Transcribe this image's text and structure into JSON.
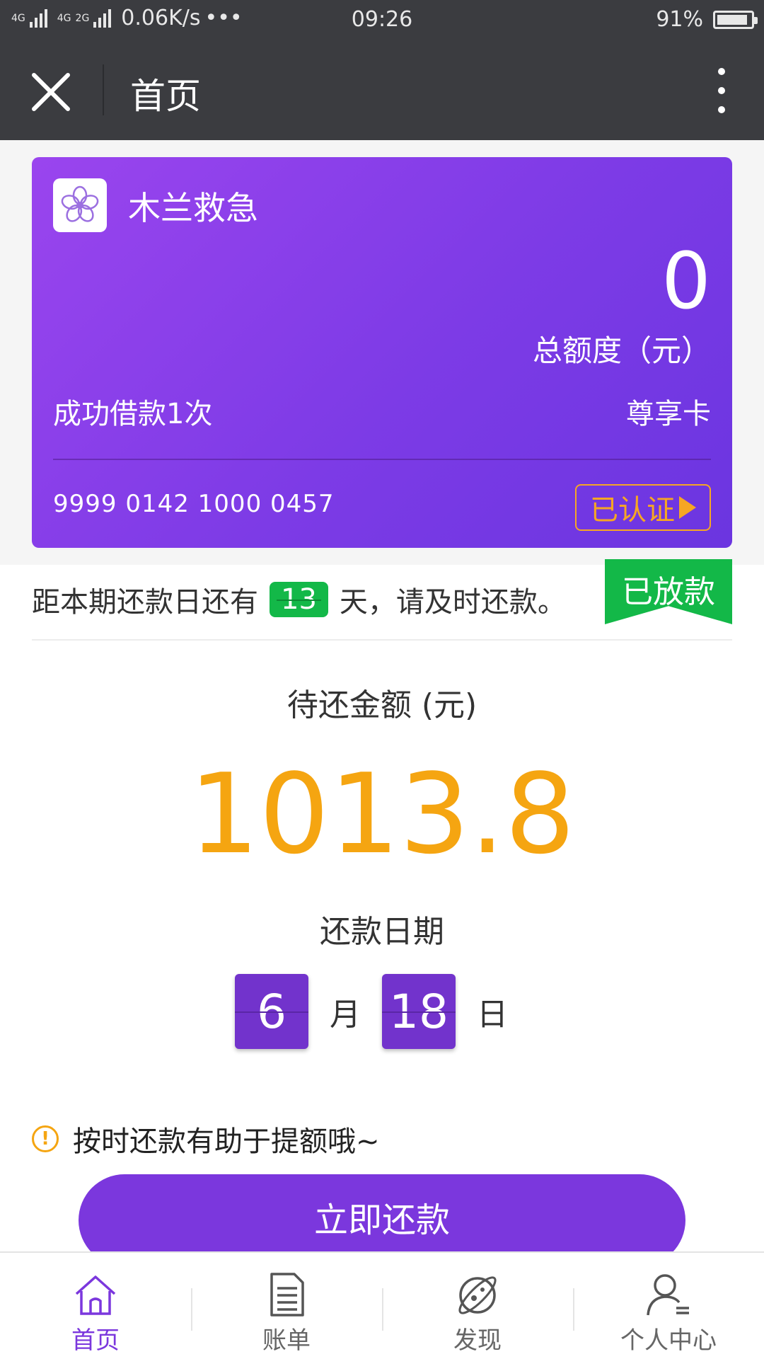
{
  "status_bar": {
    "network_a": "4G",
    "network_b": "4G",
    "network_c": "2G",
    "speed": "0.06K/s",
    "more": "•••",
    "time": "09:26",
    "battery": "91%",
    "battery_level": 0.91
  },
  "title_bar": {
    "title": "首页"
  },
  "card": {
    "brand": "木兰救急",
    "amount": "0",
    "amount_label": "总额度（元）",
    "loans": "成功借款1次",
    "type": "尊享卡",
    "number": "9999 0142 1000 0457",
    "cert_label": "已认证",
    "colors": {
      "gradient_start": "#9a45ee",
      "gradient_end": "#6b35e0",
      "accent": "#f6a623"
    }
  },
  "countdown": {
    "prefix": "距本期还款日还有",
    "days": "13",
    "suffix": "天，请及时还款。",
    "ribbon": "已放款"
  },
  "repayment": {
    "pending_label": "待还金额 (元)",
    "pending_amount": "1013.8",
    "due_label": "还款日期",
    "month": "6",
    "month_unit": "月",
    "day": "18",
    "day_unit": "日"
  },
  "tip": {
    "icon": "!",
    "text": "按时还款有助于提额哦~"
  },
  "repay_button": "立即还款",
  "tabs": [
    {
      "label": "首页",
      "icon": "home-icon",
      "active": true
    },
    {
      "label": "账单",
      "icon": "bill-icon",
      "active": false
    },
    {
      "label": "发现",
      "icon": "discover-icon",
      "active": false
    },
    {
      "label": "个人中心",
      "icon": "user-center-icon",
      "active": false
    }
  ],
  "colors": {
    "primary": "#7b37dd",
    "amount": "#f5a511",
    "success": "#13b848"
  }
}
